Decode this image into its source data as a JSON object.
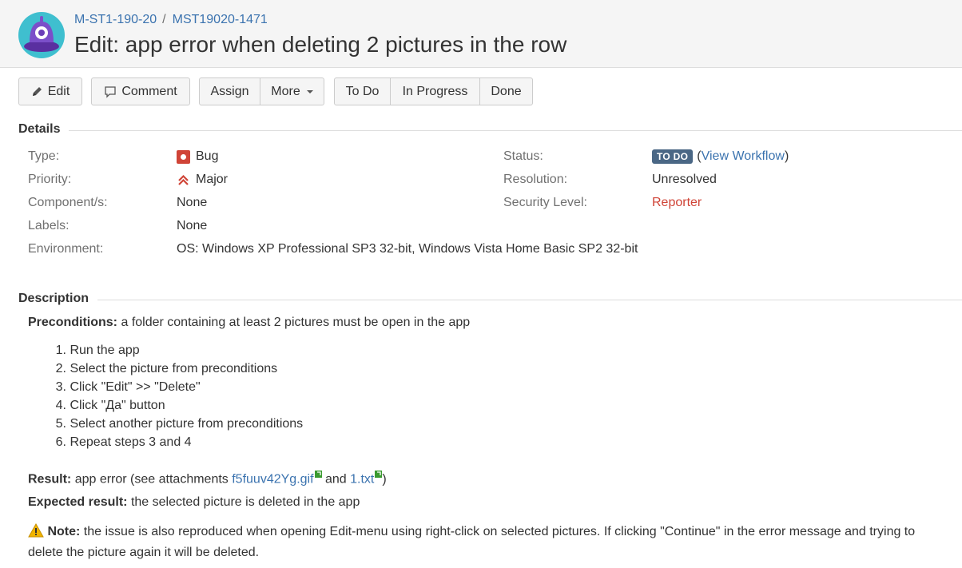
{
  "header": {
    "breadcrumb": [
      "M-ST1-190-20",
      "MST19020-1471"
    ],
    "breadcrumb_separator": "/",
    "title": "Edit: app error when deleting 2 pictures in the row"
  },
  "toolbar": {
    "edit": "Edit",
    "comment": "Comment",
    "assign": "Assign",
    "more": "More",
    "todo": "To Do",
    "in_progress": "In Progress",
    "done": "Done"
  },
  "details": {
    "title": "Details",
    "type": {
      "label": "Type:",
      "value": "Bug",
      "icon": "bug-icon"
    },
    "priority": {
      "label": "Priority:",
      "value": "Major",
      "icon": "priority-major-icon"
    },
    "components": {
      "label": "Component/s:",
      "value": "None"
    },
    "labels": {
      "label": "Labels:",
      "value": "None"
    },
    "environment": {
      "label": "Environment:",
      "value": "OS: Windows XP Professional SP3 32-bit, Windows Vista Home Basic SP2 32-bit"
    },
    "status": {
      "label": "Status:",
      "value": "TO DO",
      "workflow_link": "View Workflow"
    },
    "resolution": {
      "label": "Resolution:",
      "value": "Unresolved"
    },
    "security": {
      "label": "Security Level:",
      "value": "Reporter"
    }
  },
  "description": {
    "title": "Description",
    "preconditions_label": "Preconditions:",
    "preconditions_text": "a folder containing at least 2 pictures must be open in the app",
    "steps": [
      {
        "num": "1.",
        "text": "Run the app"
      },
      {
        "num": "2.",
        "text": "Select the picture from preconditions"
      },
      {
        "num": "3.",
        "text": "Click \"Edit\" >> \"Delete\""
      },
      {
        "num": "4.",
        "text": "Click \"Да\" button"
      },
      {
        "num": "5.",
        "text": "Select another picture from preconditions"
      },
      {
        "num": "6.",
        "text": "Repeat steps 3 and 4"
      }
    ],
    "result_label": "Result:",
    "result_prefix": "app error (see attachments",
    "attachment1": "f5fuuv42Yg.gif",
    "result_and": "and",
    "attachment2": "1.txt",
    "result_suffix": ")",
    "expected_label": "Expected result:",
    "expected_text": "the selected picture is deleted in the app",
    "note_label": "Note:",
    "note_text": "the issue is also reproduced when opening Edit-menu using right-click on selected pictures. If clicking \"Continue\" in the error message and trying to delete the picture again it will be deleted."
  },
  "colors": {
    "link": "#3b73af",
    "status_lozenge": "#4a6785",
    "bug": "#d04437",
    "reporter": "#d04437",
    "avatar_bg": "#3fbfcf",
    "avatar_body": "#7b4fc9"
  }
}
